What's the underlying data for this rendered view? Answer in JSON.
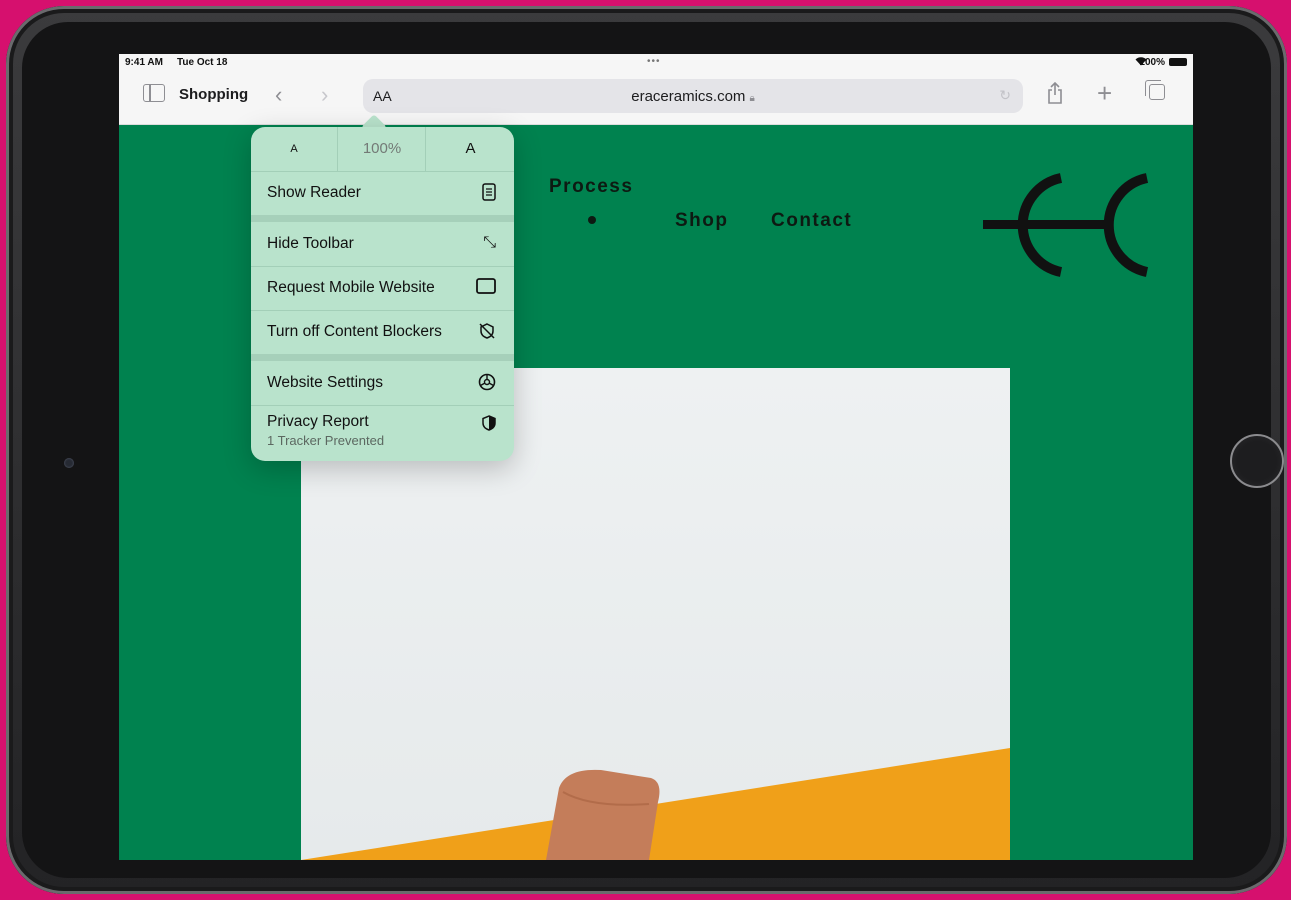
{
  "status_bar": {
    "time": "9:41 AM",
    "date": "Tue Oct 18",
    "battery": "100%"
  },
  "toolbar": {
    "tab_group": "Shopping",
    "text_size_button": "AA",
    "url": "eraceramics.com"
  },
  "site_nav": {
    "process": "Process",
    "shop": "Shop",
    "contact": "Contact"
  },
  "menu": {
    "zoom": {
      "smaller": "A",
      "level": "100%",
      "larger": "A"
    },
    "items": [
      {
        "label": "Show Reader",
        "icon": "reader-icon"
      },
      {
        "label": "Hide Toolbar",
        "icon": "expand-arrows-icon"
      },
      {
        "label": "Request Mobile Website",
        "icon": "mobile-device-icon"
      },
      {
        "label": "Turn off Content Blockers",
        "icon": "content-blocker-off-icon"
      },
      {
        "label": "Website Settings",
        "icon": "settings-gear-icon"
      },
      {
        "label": "Privacy Report",
        "sublabel": "1 Tracker Prevented",
        "icon": "privacy-shield-icon"
      }
    ]
  },
  "colors": {
    "page_background": "#00824f",
    "popover": "#b9e3cc",
    "backdrop": "#d6106e"
  }
}
